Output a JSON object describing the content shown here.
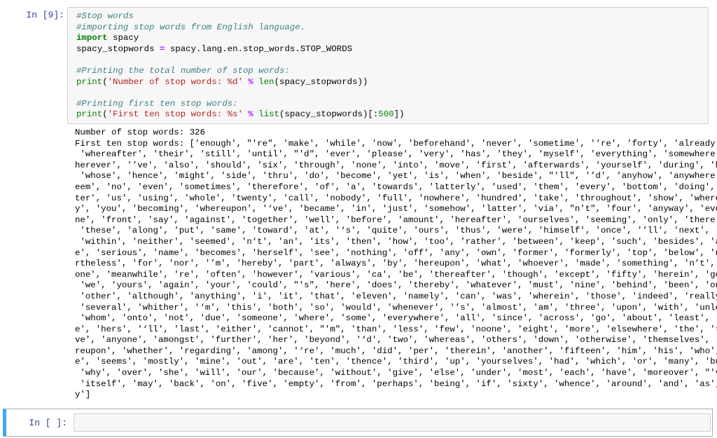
{
  "cell1": {
    "prompt": "In [9]:",
    "code_lines": [
      [
        {
          "t": "#Stop words",
          "c": "cm"
        }
      ],
      [
        {
          "t": "#importing stop words from English language.",
          "c": "cm"
        }
      ],
      [
        {
          "t": "import",
          "c": "kw"
        },
        {
          "t": " spacy",
          "c": ""
        }
      ],
      [
        {
          "t": "spacy_stopwords ",
          "c": ""
        },
        {
          "t": "=",
          "c": "op"
        },
        {
          "t": " spacy.lang.en.stop_words.STOP_WORDS",
          "c": ""
        }
      ],
      [
        {
          "t": "",
          "c": ""
        }
      ],
      [
        {
          "t": "#Printing the total number of stop words:",
          "c": "cm"
        }
      ],
      [
        {
          "t": "print",
          "c": "bi"
        },
        {
          "t": "(",
          "c": ""
        },
        {
          "t": "'Number of stop words: %d'",
          "c": "st"
        },
        {
          "t": " ",
          "c": ""
        },
        {
          "t": "%",
          "c": "op"
        },
        {
          "t": " ",
          "c": ""
        },
        {
          "t": "len",
          "c": "bi"
        },
        {
          "t": "(spacy_stopwords))",
          "c": ""
        }
      ],
      [
        {
          "t": "",
          "c": ""
        }
      ],
      [
        {
          "t": "#Printing first ten stop words:",
          "c": "cm"
        }
      ],
      [
        {
          "t": "print",
          "c": "bi"
        },
        {
          "t": "(",
          "c": ""
        },
        {
          "t": "'First ten stop words: %s'",
          "c": "st"
        },
        {
          "t": " ",
          "c": ""
        },
        {
          "t": "%",
          "c": "op"
        },
        {
          "t": " ",
          "c": ""
        },
        {
          "t": "list",
          "c": "bi"
        },
        {
          "t": "(spacy_stopwords)[:",
          "c": ""
        },
        {
          "t": "500",
          "c": "nu"
        },
        {
          "t": "])",
          "c": ""
        }
      ]
    ],
    "output_lines": [
      "Number of stop words: 326",
      "First ten stop words: ['enough', \"'re\", 'make', 'while', 'now', 'beforehand', 'never', 'sometime', '’re', 'forty', 'already',",
      " 'whereafter', 'their', 'still', 'until', \"'d\", 'ever', 'please', 'very', 'has', 'they', 'myself', 'everything', 'somewhere', 'w",
      "herever', '’ve', 'also', 'should', 'six', 'through', 'none', 'into', 'move', 'first', 'afterwards', 'yourself', 'during', 'he',",
      " 'whose', 'hence', 'might', 'side', 'thru', 'do', 'become', 'yet', 'is', 'when', 'beside', \"'ll\", '’d', 'anyhow', 'anywhere', 's",
      "eem', 'no', 'even', 'sometimes', 'therefore', 'of', 'a', 'towards', 'latterly', 'used', 'them', 'every', 'bottom', 'doing', 'af",
      "ter', 'us', 'using', 'whole', 'twenty', 'call', 'nobody', 'full', 'nowhere', 'hundred', 'take', 'throughout', 'show', 'whereb",
      "y', 'you', 'becoming', 'whereupon', '‘ve', 'became', 'in', 'just', 'somehow', 'latter', 'via', \"n't\", 'four', 'anyway', 'everyo",
      "ne', 'front', 'say', 'against', 'together', 'well', 'before', 'amount', 'hereafter', 'ourselves', 'seeming', 'only', 'there',",
      " 'these', 'along', 'put', 'same', 'toward', 'at', '‘s', 'quite', 'ours', 'thus', 'were', 'himself', 'once', '’ll', 'next', 'to',",
      " 'within', 'neither', 'seemed', 'n‘t', 'an', 'its', 'then', 'how', 'too', 'rather', 'between', 'keep', 'such', 'besides', 'abov",
      "e', 'serious', 'name', 'becomes', 'herself', 'see', 'nothing', 'off', 'any', 'own', 'former', 'formerly', 'top', 'below', 'neve",
      "rtheless', 'for', 'nor', '’m', 'hereby', 'part', 'always', 'by', 'hereupon', 'what', 'whoever', 'made', 'something', 'n’t', 'al",
      "one', 'meanwhile', 're', 'often', 'however', 'various', 'ca', 'be', 'thereafter', 'though', 'except', 'fifty', 'herein', 'get',",
      " 'we', 'yours', 'again', 'your', 'could', \"'s\", 'here', 'does', 'thereby', 'whatever', 'must', 'nine', 'behind', 'been', 'one',",
      " 'other', 'although', 'anything', 'i', 'it', 'that', 'eleven', 'namely', 'can', 'was', 'wherein', 'those', 'indeed', 'really',",
      " 'several', 'whither', '‘m', 'this', 'both', 'so', 'would', 'whenever', '’s', 'almost', 'am', 'three', 'upon', 'with', 'unless',",
      " 'whom', 'onto', 'not', 'due', 'someone', 'where', 'some', 'everywhere', 'all', 'since', 'across', 'go', 'about', 'least', 'don",
      "e', 'hers', '‘ll', 'last', 'either', 'cannot', \"'m\", 'than', 'less', 'few', 'noone', 'eight', 'more', 'elsewhere', 'the', 'twel",
      "ve', 'anyone', 'amongst', 'further', 'her', 'beyond', '‘d', 'two', 'whereas', 'others', 'down', 'otherwise', 'themselves', 'the",
      "reupon', 'whether', 'regarding', 'among', '‘re', 'much', 'did', 'per', 'therein', 'another', 'fifteen', 'him', 'his', 'who', 'm",
      "e', 'seems', 'mostly', 'mine', 'out', 'are', 'ten', 'thence', 'third', 'up', 'yourselves', 'had', 'which', 'or', 'many', 'but',",
      " 'why', 'over', 'she', 'will', 'our', 'because', 'without', 'give', 'else', 'under', 'most', 'each', 'have', 'moreover', \"'ve\",",
      " 'itself', 'may', 'back', 'on', 'five', 'empty', 'from', 'perhaps', 'being', 'if', 'sixty', 'whence', 'around', 'and', 'as', 'm",
      "y']"
    ]
  },
  "cell2": {
    "prompt": "In [ ]:",
    "code": ""
  },
  "colors": {
    "prompt": "#303f9f",
    "selected_cell_bar": "#42a5f5",
    "code_bg": "#f7f7f7"
  }
}
